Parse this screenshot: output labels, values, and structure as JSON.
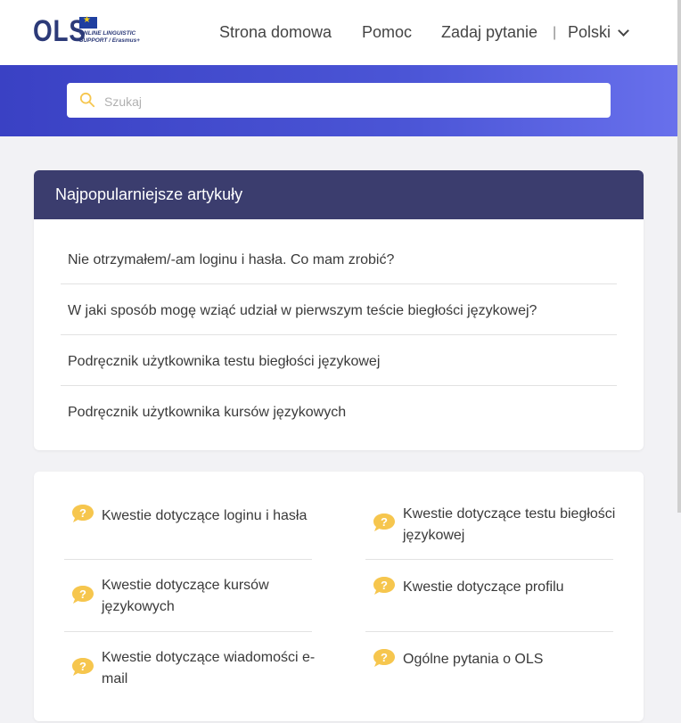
{
  "header": {
    "logo_text": "OLS",
    "logo_subtitle_1": "ONLINE LINGUISTIC",
    "logo_subtitle_2": "SUPPORT / Erasmus+",
    "nav": [
      "Strona domowa",
      "Pomoc",
      "Zadaj pytanie"
    ],
    "separator": "|",
    "language": "Polski"
  },
  "search": {
    "placeholder": "Szukaj",
    "value": ""
  },
  "popular": {
    "title": "Najpopularniejsze artykuły",
    "articles": [
      "Nie otrzymałem/-am loginu i hasła. Co mam zrobić?",
      "W jaki sposób mogę wziąć udział w pierwszym teście biegłości językowej?",
      "Podręcznik użytkownika testu biegłości językowej",
      "Podręcznik użytkownika kursów językowych"
    ]
  },
  "categories": [
    {
      "label": "Kwestie dotyczące loginu i hasła",
      "icon": "question-bubble-icon"
    },
    {
      "label": "Kwestie dotyczące testu biegłości językowej",
      "icon": "question-bubble-icon"
    },
    {
      "label": "Kwestie dotyczące kursów językowych",
      "icon": "question-bubble-icon"
    },
    {
      "label": "Kwestie dotyczące profilu",
      "icon": "question-bubble-icon"
    },
    {
      "label": "Kwestie dotyczące wiadomości e-mail",
      "icon": "question-bubble-icon"
    },
    {
      "label": "Ogólne pytania o OLS",
      "icon": "question-bubble-icon"
    }
  ],
  "colors": {
    "hero_gradient_start": "#3a41c4",
    "hero_gradient_end": "#6870ec",
    "card_header": "#3b3d6e",
    "icon_accent": "#f6c64e",
    "logo": "#2c3a78"
  }
}
